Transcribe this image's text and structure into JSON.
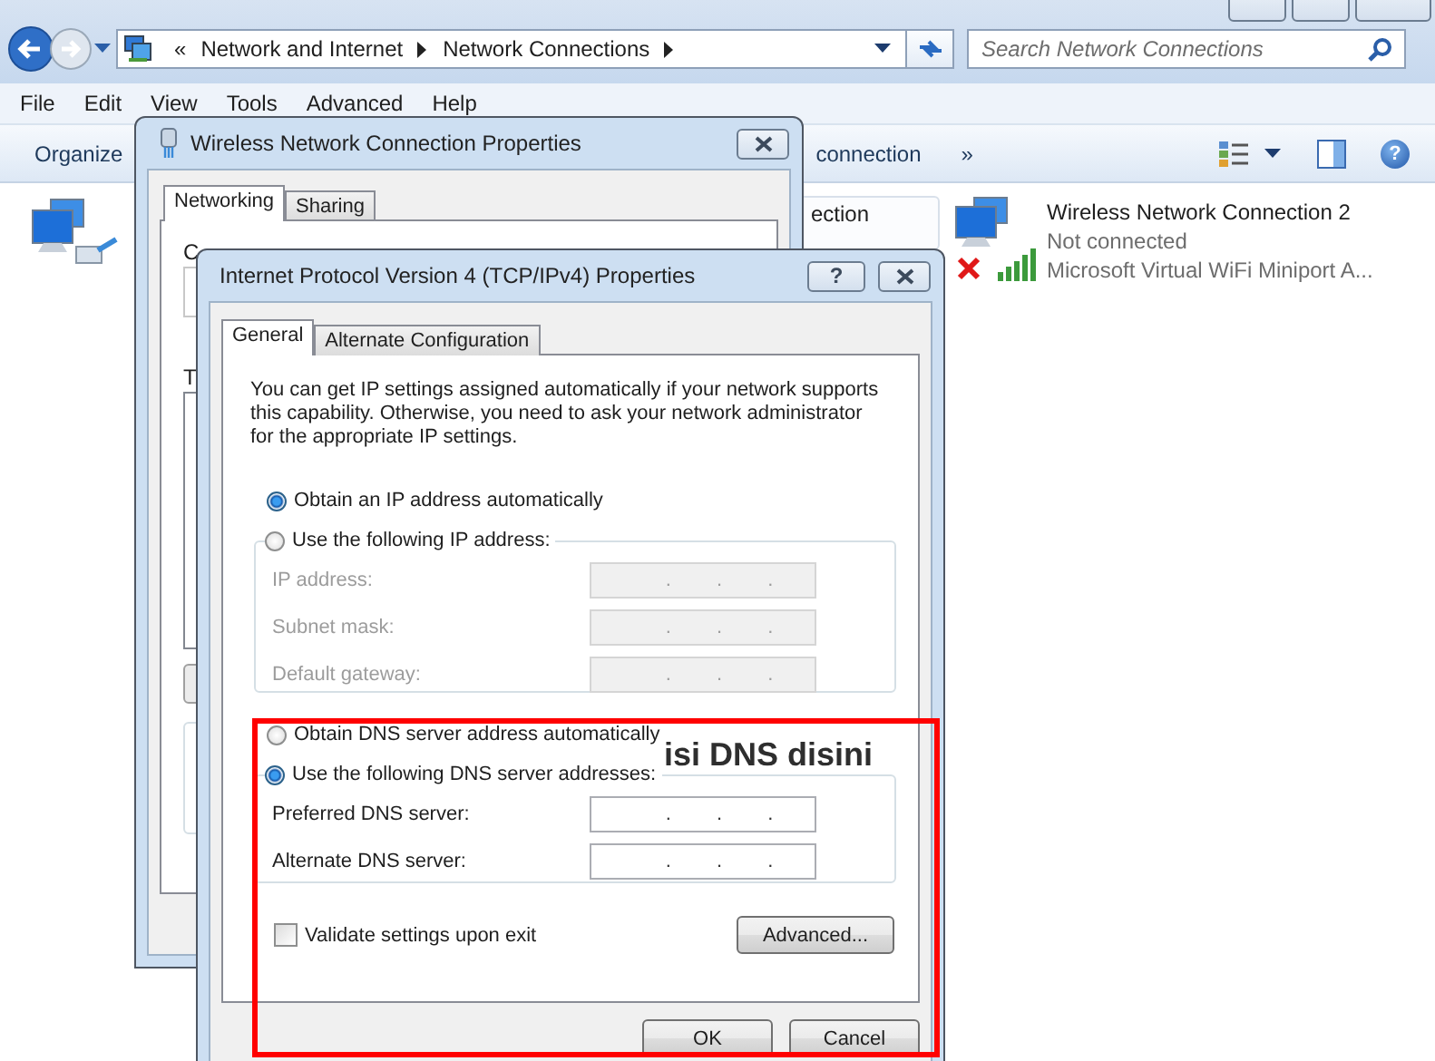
{
  "explorer": {
    "address": {
      "overflow": "«",
      "crumbs": [
        "Network and Internet",
        "Network Connections"
      ]
    },
    "search": {
      "placeholder": "Search Network Connections"
    },
    "menu": [
      "File",
      "Edit",
      "View",
      "Tools",
      "Advanced",
      "Help"
    ],
    "toolbar": {
      "organize": "Organize",
      "command": "connection",
      "more": "»",
      "help": "?"
    },
    "items": [
      {
        "kind": "covered"
      },
      {
        "kind": "partial",
        "name": "ection"
      },
      {
        "kind": "adapter",
        "name": "Wireless Network Connection 2",
        "status": "Not connected",
        "device": "Microsoft Virtual WiFi Miniport A...",
        "connected": false
      }
    ]
  },
  "wireless_dialog": {
    "title": "Wireless Network Connection Properties",
    "tabs": [
      {
        "label": "Networking",
        "selected": true
      },
      {
        "label": "Sharing",
        "selected": false
      }
    ],
    "fragments": [
      "C",
      "T"
    ]
  },
  "ipv4_dialog": {
    "title": "Internet Protocol Version 4 (TCP/IPv4) Properties",
    "help": "?",
    "tabs": [
      {
        "label": "General",
        "selected": true
      },
      {
        "label": "Alternate Configuration",
        "selected": false
      }
    ],
    "intro": "You can get IP settings assigned automatically if your network supports this capability. Otherwise, you need to ask your network administrator for the appropriate IP settings.",
    "ip_options": [
      {
        "label": "Obtain an IP address automatically",
        "selected": true
      },
      {
        "label": "Use the following IP address:",
        "selected": false
      }
    ],
    "ip_fields": [
      {
        "label": "IP address:",
        "value": ". . .",
        "disabled": true
      },
      {
        "label": "Subnet mask:",
        "value": ". . .",
        "disabled": true
      },
      {
        "label": "Default gateway:",
        "value": ". . .",
        "disabled": true
      }
    ],
    "dns_options": [
      {
        "label": "Obtain DNS server address automatically",
        "selected": false
      },
      {
        "label": "Use the following DNS server addresses:",
        "selected": true
      }
    ],
    "dns_fields": [
      {
        "label": "Preferred DNS server:",
        "value": ". . .",
        "disabled": false
      },
      {
        "label": "Alternate DNS server:",
        "value": ". . .",
        "disabled": false
      }
    ],
    "validate": {
      "label": "Validate settings upon exit",
      "checked": false
    },
    "advanced": "Advanced...",
    "ok": "OK",
    "cancel": "Cancel"
  },
  "annotation": {
    "text": "isi DNS disini"
  }
}
